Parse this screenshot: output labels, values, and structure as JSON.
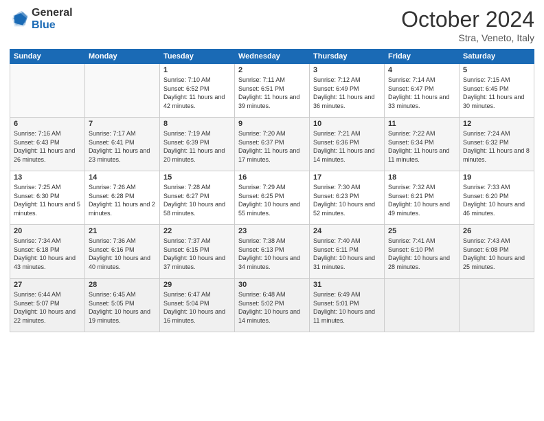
{
  "logo": {
    "general": "General",
    "blue": "Blue"
  },
  "title": "October 2024",
  "location": "Stra, Veneto, Italy",
  "headers": [
    "Sunday",
    "Monday",
    "Tuesday",
    "Wednesday",
    "Thursday",
    "Friday",
    "Saturday"
  ],
  "weeks": [
    [
      {
        "day": "",
        "info": ""
      },
      {
        "day": "",
        "info": ""
      },
      {
        "day": "1",
        "info": "Sunrise: 7:10 AM\nSunset: 6:52 PM\nDaylight: 11 hours and 42 minutes."
      },
      {
        "day": "2",
        "info": "Sunrise: 7:11 AM\nSunset: 6:51 PM\nDaylight: 11 hours and 39 minutes."
      },
      {
        "day": "3",
        "info": "Sunrise: 7:12 AM\nSunset: 6:49 PM\nDaylight: 11 hours and 36 minutes."
      },
      {
        "day": "4",
        "info": "Sunrise: 7:14 AM\nSunset: 6:47 PM\nDaylight: 11 hours and 33 minutes."
      },
      {
        "day": "5",
        "info": "Sunrise: 7:15 AM\nSunset: 6:45 PM\nDaylight: 11 hours and 30 minutes."
      }
    ],
    [
      {
        "day": "6",
        "info": "Sunrise: 7:16 AM\nSunset: 6:43 PM\nDaylight: 11 hours and 26 minutes."
      },
      {
        "day": "7",
        "info": "Sunrise: 7:17 AM\nSunset: 6:41 PM\nDaylight: 11 hours and 23 minutes."
      },
      {
        "day": "8",
        "info": "Sunrise: 7:19 AM\nSunset: 6:39 PM\nDaylight: 11 hours and 20 minutes."
      },
      {
        "day": "9",
        "info": "Sunrise: 7:20 AM\nSunset: 6:37 PM\nDaylight: 11 hours and 17 minutes."
      },
      {
        "day": "10",
        "info": "Sunrise: 7:21 AM\nSunset: 6:36 PM\nDaylight: 11 hours and 14 minutes."
      },
      {
        "day": "11",
        "info": "Sunrise: 7:22 AM\nSunset: 6:34 PM\nDaylight: 11 hours and 11 minutes."
      },
      {
        "day": "12",
        "info": "Sunrise: 7:24 AM\nSunset: 6:32 PM\nDaylight: 11 hours and 8 minutes."
      }
    ],
    [
      {
        "day": "13",
        "info": "Sunrise: 7:25 AM\nSunset: 6:30 PM\nDaylight: 11 hours and 5 minutes."
      },
      {
        "day": "14",
        "info": "Sunrise: 7:26 AM\nSunset: 6:28 PM\nDaylight: 11 hours and 2 minutes."
      },
      {
        "day": "15",
        "info": "Sunrise: 7:28 AM\nSunset: 6:27 PM\nDaylight: 10 hours and 58 minutes."
      },
      {
        "day": "16",
        "info": "Sunrise: 7:29 AM\nSunset: 6:25 PM\nDaylight: 10 hours and 55 minutes."
      },
      {
        "day": "17",
        "info": "Sunrise: 7:30 AM\nSunset: 6:23 PM\nDaylight: 10 hours and 52 minutes."
      },
      {
        "day": "18",
        "info": "Sunrise: 7:32 AM\nSunset: 6:21 PM\nDaylight: 10 hours and 49 minutes."
      },
      {
        "day": "19",
        "info": "Sunrise: 7:33 AM\nSunset: 6:20 PM\nDaylight: 10 hours and 46 minutes."
      }
    ],
    [
      {
        "day": "20",
        "info": "Sunrise: 7:34 AM\nSunset: 6:18 PM\nDaylight: 10 hours and 43 minutes."
      },
      {
        "day": "21",
        "info": "Sunrise: 7:36 AM\nSunset: 6:16 PM\nDaylight: 10 hours and 40 minutes."
      },
      {
        "day": "22",
        "info": "Sunrise: 7:37 AM\nSunset: 6:15 PM\nDaylight: 10 hours and 37 minutes."
      },
      {
        "day": "23",
        "info": "Sunrise: 7:38 AM\nSunset: 6:13 PM\nDaylight: 10 hours and 34 minutes."
      },
      {
        "day": "24",
        "info": "Sunrise: 7:40 AM\nSunset: 6:11 PM\nDaylight: 10 hours and 31 minutes."
      },
      {
        "day": "25",
        "info": "Sunrise: 7:41 AM\nSunset: 6:10 PM\nDaylight: 10 hours and 28 minutes."
      },
      {
        "day": "26",
        "info": "Sunrise: 7:43 AM\nSunset: 6:08 PM\nDaylight: 10 hours and 25 minutes."
      }
    ],
    [
      {
        "day": "27",
        "info": "Sunrise: 6:44 AM\nSunset: 5:07 PM\nDaylight: 10 hours and 22 minutes."
      },
      {
        "day": "28",
        "info": "Sunrise: 6:45 AM\nSunset: 5:05 PM\nDaylight: 10 hours and 19 minutes."
      },
      {
        "day": "29",
        "info": "Sunrise: 6:47 AM\nSunset: 5:04 PM\nDaylight: 10 hours and 16 minutes."
      },
      {
        "day": "30",
        "info": "Sunrise: 6:48 AM\nSunset: 5:02 PM\nDaylight: 10 hours and 14 minutes."
      },
      {
        "day": "31",
        "info": "Sunrise: 6:49 AM\nSunset: 5:01 PM\nDaylight: 10 hours and 11 minutes."
      },
      {
        "day": "",
        "info": ""
      },
      {
        "day": "",
        "info": ""
      }
    ]
  ]
}
